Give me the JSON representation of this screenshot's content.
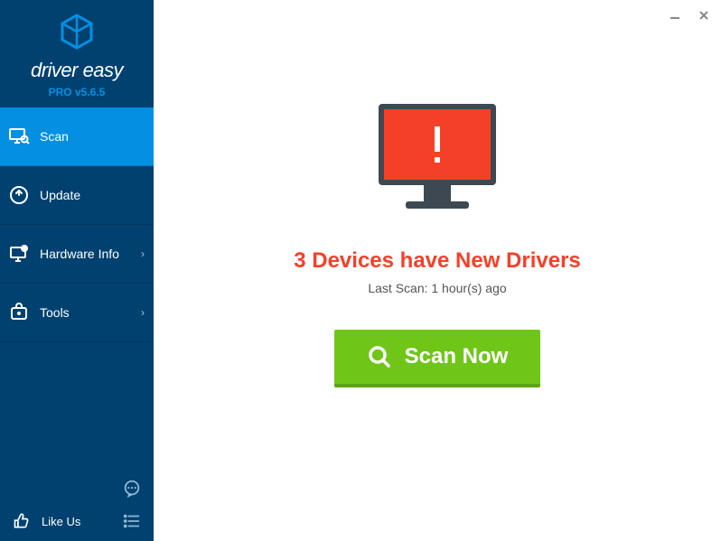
{
  "brand": {
    "name": "driver easy",
    "version": "PRO v5.6.5"
  },
  "nav": {
    "scan": "Scan",
    "update": "Update",
    "hardware": "Hardware Info",
    "tools": "Tools"
  },
  "footer": {
    "like": "Like Us"
  },
  "main": {
    "headline": "3 Devices have New Drivers",
    "subline": "Last Scan: 1 hour(s) ago",
    "scan_button": "Scan Now"
  }
}
